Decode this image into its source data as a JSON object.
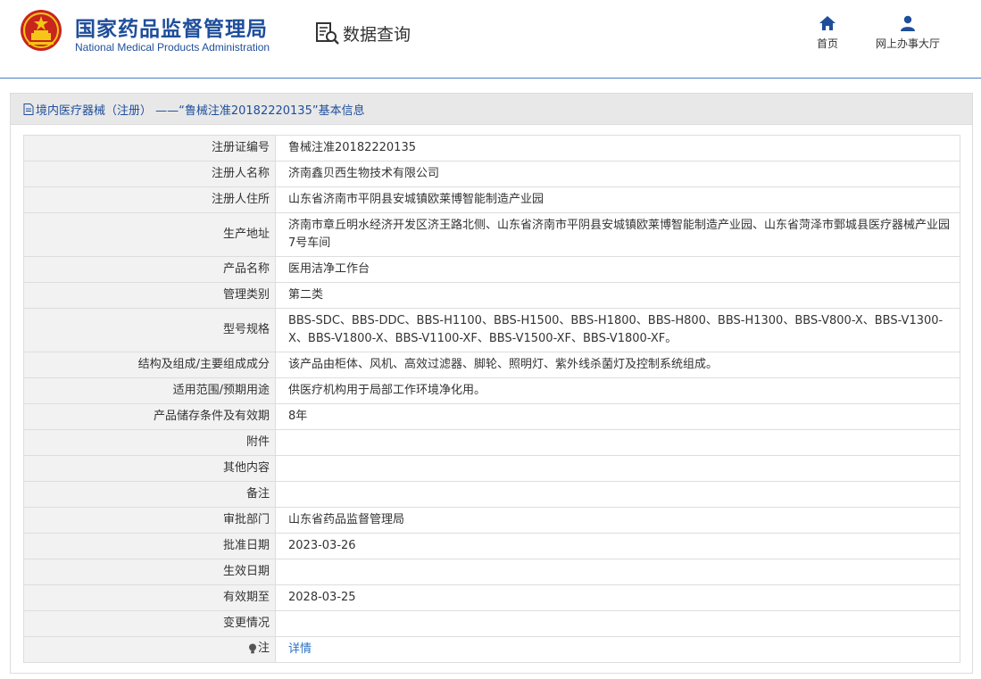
{
  "header": {
    "brand_cn": "国家药品监督管理局",
    "brand_en": "National Medical Products Administration",
    "query_label": "数据查询",
    "nav": [
      {
        "label": "首页",
        "icon": "home-icon"
      },
      {
        "label": "网上办事大厅",
        "icon": "user-icon"
      }
    ]
  },
  "panel": {
    "title": "境内医疗器械（注册） ——“鲁械注准20182220135”基本信息",
    "rows": [
      {
        "label": "注册证编号",
        "value": "鲁械注准20182220135"
      },
      {
        "label": "注册人名称",
        "value": "济南鑫贝西生物技术有限公司"
      },
      {
        "label": "注册人住所",
        "value": "山东省济南市平阴县安城镇欧莱博智能制造产业园"
      },
      {
        "label": "生产地址",
        "value": "济南市章丘明水经济开发区济王路北侧、山东省济南市平阴县安城镇欧莱博智能制造产业园、山东省菏泽市鄄城县医疗器械产业园7号车间"
      },
      {
        "label": "产品名称",
        "value": "医用洁净工作台"
      },
      {
        "label": "管理类别",
        "value": "第二类"
      },
      {
        "label": "型号规格",
        "value": "BBS-SDC、BBS-DDC、BBS-H1100、BBS-H1500、BBS-H1800、BBS-H800、BBS-H1300、BBS-V800-X、BBS-V1300-X、BBS-V1800-X、BBS-V1100-XF、BBS-V1500-XF、BBS-V1800-XF。"
      },
      {
        "label": "结构及组成/主要组成成分",
        "value": "该产品由柜体、风机、高效过滤器、脚轮、照明灯、紫外线杀菌灯及控制系统组成。"
      },
      {
        "label": "适用范围/预期用途",
        "value": "供医疗机构用于局部工作环境净化用。"
      },
      {
        "label": "产品储存条件及有效期",
        "value": "8年"
      },
      {
        "label": "附件",
        "value": ""
      },
      {
        "label": "其他内容",
        "value": ""
      },
      {
        "label": "备注",
        "value": ""
      },
      {
        "label": "审批部门",
        "value": "山东省药品监督管理局"
      },
      {
        "label": "批准日期",
        "value": "2023-03-26"
      },
      {
        "label": "生效日期",
        "value": ""
      },
      {
        "label": "有效期至",
        "value": "2028-03-25"
      },
      {
        "label": "变更情况",
        "value": ""
      }
    ],
    "note": {
      "label": "注",
      "link": "详情"
    }
  },
  "colors": {
    "brand_blue": "#1f4e9a",
    "link_blue": "#2a70c7",
    "label_bg": "#f2f2f2",
    "panel_head_bg": "#e8e8e8"
  }
}
